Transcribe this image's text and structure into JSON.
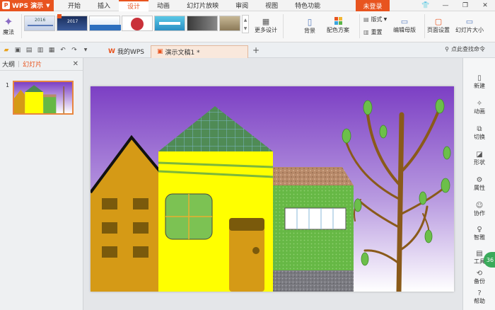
{
  "app": {
    "logo_label": "WPS 演示",
    "menu": [
      "开始",
      "插入",
      "设计",
      "动画",
      "幻灯片放映",
      "审阅",
      "视图",
      "特色功能"
    ],
    "active_menu": "设计",
    "login_label": "未登录"
  },
  "ribbon": {
    "magic_label": "魔法",
    "more_design_label": "更多设计",
    "background_label": "背景",
    "color_scheme_label": "配色方案",
    "layout_label": "版式",
    "reset_label": "重置",
    "edit_master_label": "编辑母版",
    "page_setup_label": "页面设置",
    "slide_size_label": "幻灯片大小",
    "thumb1_text": "2016",
    "thumb2_text": "2017"
  },
  "docbar": {
    "tabs": [
      {
        "label": "我的WPS"
      },
      {
        "label": "演示文稿1 *"
      }
    ],
    "search_label": "点此查找命令"
  },
  "leftpanel": {
    "tab_outline": "大纲",
    "tab_slides": "幻灯片",
    "slide_number": "1"
  },
  "rightbar": {
    "items": [
      "新建",
      "动画",
      "切换",
      "形状",
      "属性",
      "协作",
      "智雅",
      "工具",
      "备份",
      "帮助"
    ]
  },
  "badge": "36",
  "colors": {
    "accent": "#e8541f",
    "sky_top": "#7c3fc4",
    "house_yellow": "#ffff00",
    "tall_house": "#d59a16",
    "grass_green": "#66b845"
  }
}
